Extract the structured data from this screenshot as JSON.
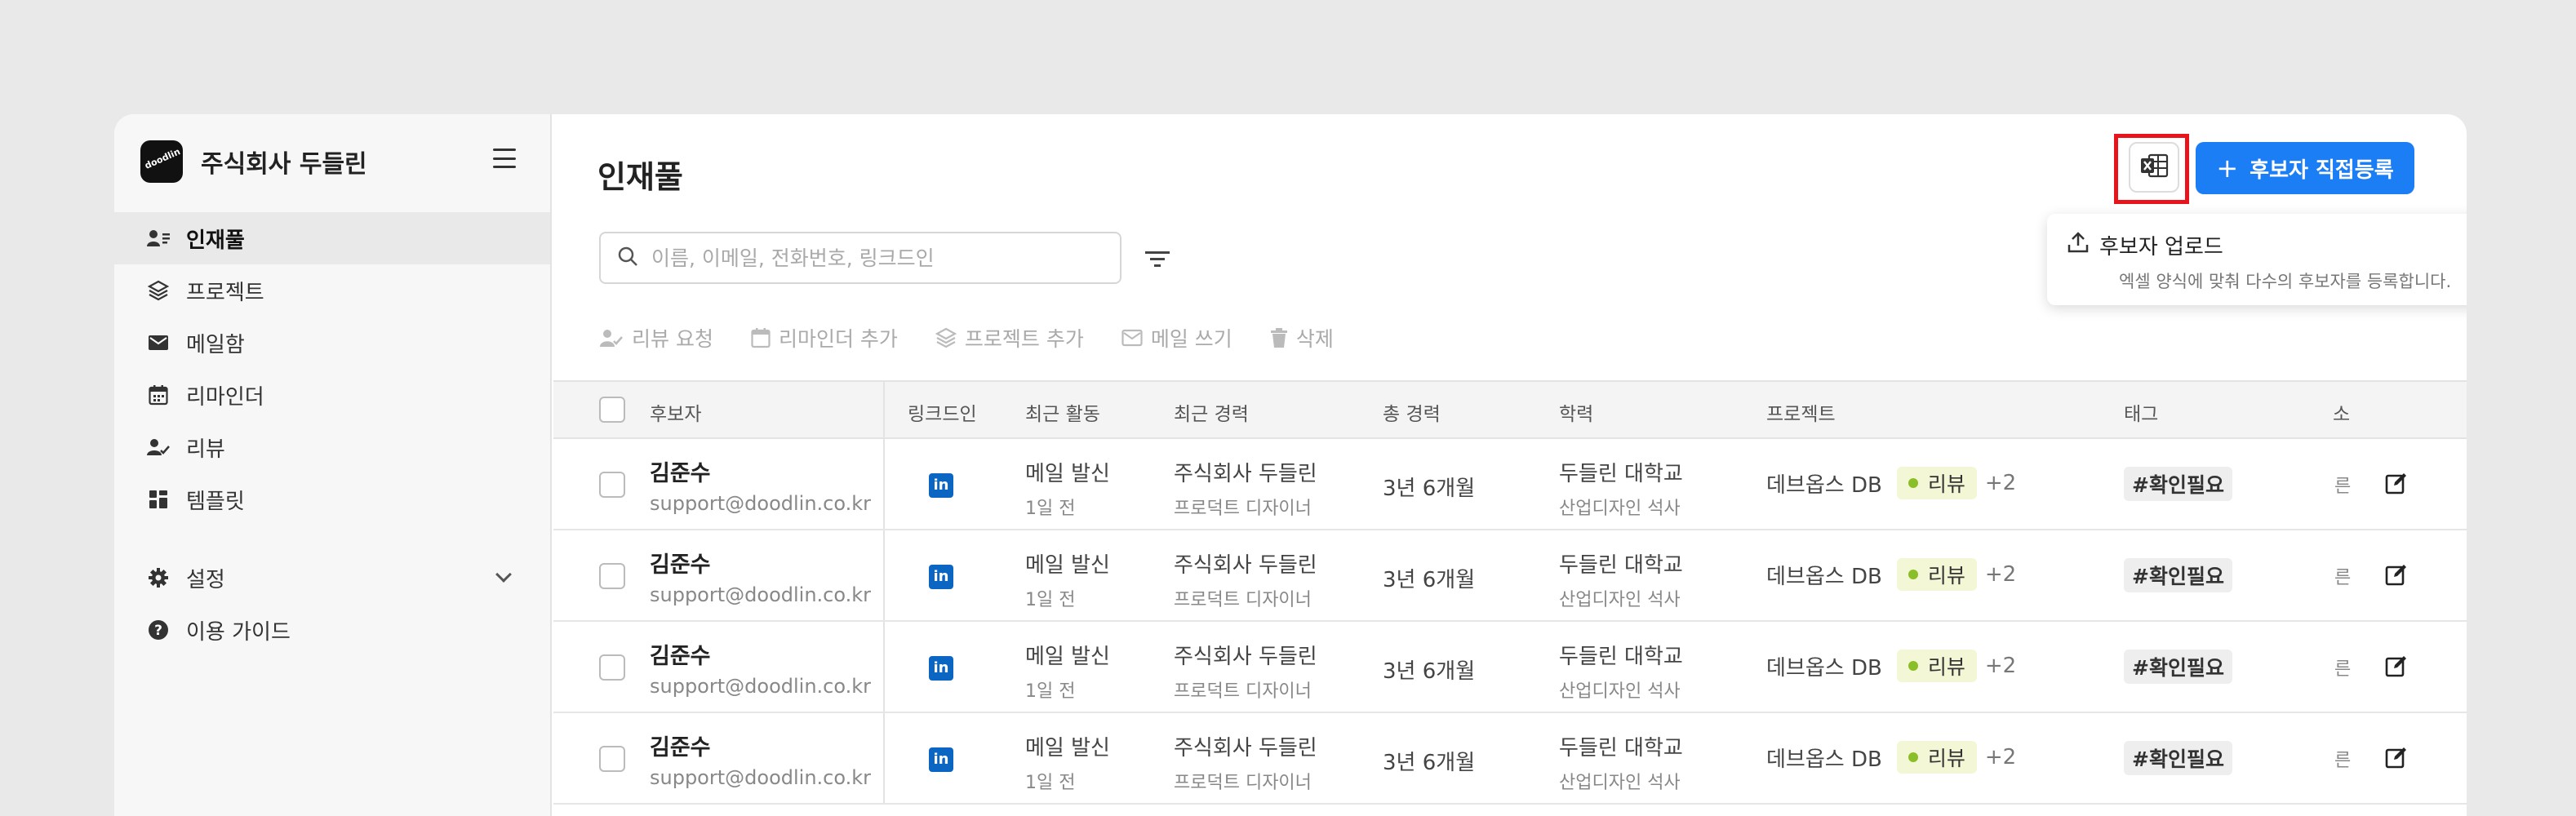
{
  "sidebar": {
    "company": "주식회사 두들린",
    "logo_text": "doodlin",
    "items": [
      {
        "label": "인재풀",
        "icon": "user-list-icon"
      },
      {
        "label": "프로젝트",
        "icon": "layers-icon"
      },
      {
        "label": "메일함",
        "icon": "mail-icon"
      },
      {
        "label": "리마인더",
        "icon": "calendar-icon"
      },
      {
        "label": "리뷰",
        "icon": "user-check-icon"
      },
      {
        "label": "템플릿",
        "icon": "grid-icon"
      }
    ],
    "settings": {
      "label": "설정",
      "icon": "gear-icon"
    },
    "guide": {
      "label": "이용 가이드",
      "icon": "help-icon"
    }
  },
  "header": {
    "title": "인재풀",
    "register_button": "후보자 직접등록"
  },
  "search": {
    "placeholder": "이름, 이메일, 전화번호, 링크드인"
  },
  "dropdown": {
    "title": "후보자 업로드",
    "subtitle": "엑셀 양식에 맞춰 다수의 후보자를 등록합니다."
  },
  "toolbar": {
    "review": "리뷰 요청",
    "reminder": "리마인더 추가",
    "project": "프로젝트 추가",
    "mail": "메일 쓰기",
    "delete": "삭제"
  },
  "table": {
    "headers": {
      "candidate": "후보자",
      "linkedin": "링크드인",
      "activity": "최근 활동",
      "career": "최근 경력",
      "total": "총 경력",
      "education": "학력",
      "project": "프로젝트",
      "tag": "태그",
      "extra": "소"
    },
    "rows": [
      {
        "name": "김준수",
        "email": "support@doodlin.co.kr",
        "activity": "메일 발신",
        "activity_time": "1일 전",
        "company": "주식회사 두들린",
        "role": "프로덕트 디자이너",
        "total": "3년 6개월",
        "school": "두들린 대학교",
        "major": "산업디자인 석사",
        "project": "데브옵스 DB",
        "status": "리뷰",
        "more": "+2",
        "tag": "#확인필요",
        "extra": "른"
      },
      {
        "name": "김준수",
        "email": "support@doodlin.co.kr",
        "activity": "메일 발신",
        "activity_time": "1일 전",
        "company": "주식회사 두들린",
        "role": "프로덕트 디자이너",
        "total": "3년 6개월",
        "school": "두들린 대학교",
        "major": "산업디자인 석사",
        "project": "데브옵스 DB",
        "status": "리뷰",
        "more": "+2",
        "tag": "#확인필요",
        "extra": "른"
      },
      {
        "name": "김준수",
        "email": "support@doodlin.co.kr",
        "activity": "메일 발신",
        "activity_time": "1일 전",
        "company": "주식회사 두들린",
        "role": "프로덕트 디자이너",
        "total": "3년 6개월",
        "school": "두들린 대학교",
        "major": "산업디자인 석사",
        "project": "데브옵스 DB",
        "status": "리뷰",
        "more": "+2",
        "tag": "#확인필요",
        "extra": "른"
      },
      {
        "name": "김준수",
        "email": "support@doodlin.co.kr",
        "activity": "메일 발신",
        "activity_time": "1일 전",
        "company": "주식회사 두들린",
        "role": "프로덕트 디자이너",
        "total": "3년 6개월",
        "school": "두들린 대학교",
        "major": "산업디자인 석사",
        "project": "데브옵스 DB",
        "status": "리뷰",
        "more": "+2",
        "tag": "#확인필요",
        "extra": "른"
      }
    ]
  },
  "colors": {
    "primary": "#1c7ef4",
    "highlight": "#e8141c",
    "linkedin": "#0a66c2",
    "status_dot": "#8bbf2a",
    "status_bg": "#f3f7d6"
  }
}
